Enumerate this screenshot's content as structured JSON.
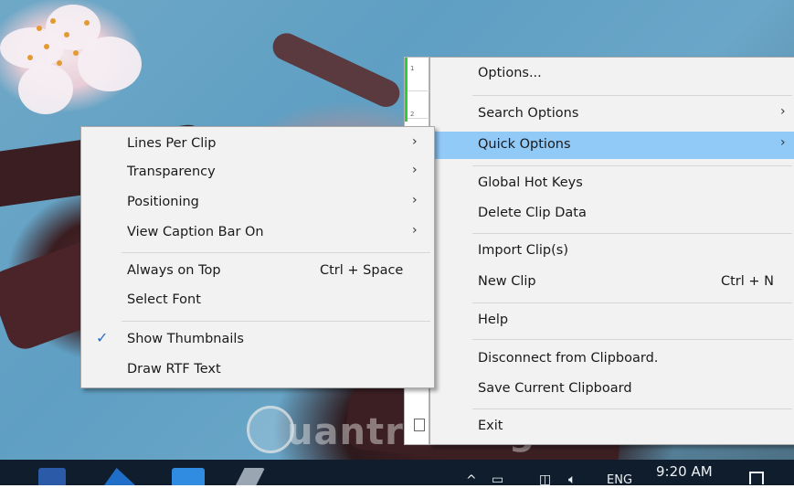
{
  "quick_options_menu": {
    "items": [
      {
        "label": "Lines Per Clip",
        "submenu": true
      },
      {
        "label": "Transparency",
        "submenu": true
      },
      {
        "label": "Positioning",
        "submenu": true
      },
      {
        "label": "View Caption Bar On",
        "submenu": true
      },
      {
        "label": "Always on Top",
        "shortcut": "Ctrl + Space"
      },
      {
        "label": "Select Font"
      },
      {
        "label": "Show Thumbnails",
        "checked": true
      },
      {
        "label": "Draw RTF Text"
      }
    ]
  },
  "main_menu": {
    "items": [
      {
        "label": "Options..."
      },
      {
        "label": "Search Options",
        "submenu": true
      },
      {
        "label": "Quick Options",
        "submenu": true,
        "highlighted": true
      },
      {
        "label": "Global Hot Keys"
      },
      {
        "label": "Delete Clip Data"
      },
      {
        "label": "Import Clip(s)"
      },
      {
        "label": "New Clip",
        "shortcut": "Ctrl + N"
      },
      {
        "label": "Help"
      },
      {
        "label": "Disconnect from Clipboard."
      },
      {
        "label": "Save Current Clipboard"
      },
      {
        "label": "Exit"
      }
    ]
  },
  "ditto_window": {
    "row_numbers": [
      "1",
      "2"
    ]
  },
  "taskbar": {
    "time": "9:20 AM",
    "language": "ENG",
    "tray_chevron": "^"
  },
  "watermark": {
    "text": "uantrimang"
  },
  "colors": {
    "menu_background": "#f2f2f2",
    "highlight": "#91c9f7",
    "checkmark": "#2a6ec0",
    "clip_indicator": "#2fcc3b",
    "taskbar": "#0f1d2c"
  }
}
